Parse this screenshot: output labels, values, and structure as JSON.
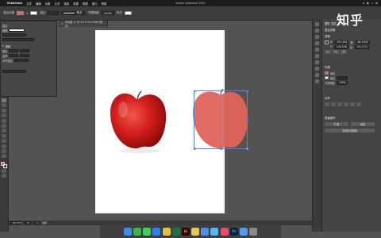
{
  "menubar": {
    "apple": "",
    "app_name": "Illustrator",
    "menus": [
      "文件",
      "编辑",
      "对象",
      "文字",
      "选择",
      "效果",
      "视图",
      "窗口",
      "帮助"
    ],
    "window_title": "Adobe Illustrator 2021",
    "status_items": [
      "⌂",
      "◐",
      "⌕",
      "⚙"
    ]
  },
  "controlbar": {
    "label_path": "混合对象",
    "stroke_label": "描边",
    "stroke_value": "",
    "style_label": "基本",
    "opacity_label": "不透明度",
    "opacity_value": "100%",
    "style_name": "样式"
  },
  "doctab": {
    "name": "未标题-1* @ 50.77% (CMYK/预览)",
    "close": "×"
  },
  "strokepanel": {
    "header": "描边",
    "weight_label": "粗细",
    "section2": "透明",
    "rows": [
      "端点",
      "边角",
      "对齐描边"
    ]
  },
  "properties": {
    "tabs": [
      "属性",
      "图层",
      "库"
    ],
    "header_selection": "混合对象",
    "transform_header": "变换",
    "x_label": "X:",
    "x_value": "303.164",
    "w_label": "宽:",
    "w_value": "88.1509",
    "y_label": "Y:",
    "y_value": "146.546",
    "h_label": "高:",
    "h_value": "93.2711",
    "appearance_header": "外观",
    "fill_label": "填色",
    "stroke_label": "描边",
    "opacity_label": "不透明度",
    "opacity_value": "100%",
    "align_header": "对齐",
    "quick_header": "快速操作",
    "btn_expand": "扩展",
    "btn_release": "释放",
    "btn_recolor": "重新着色图稿"
  },
  "statusbar": {
    "zoom": "50.77%",
    "angle": "0°",
    "page": "1",
    "tool": "选择"
  },
  "dock": {
    "icons": [
      {
        "name": "finder",
        "label": "",
        "color": "#3b8ef0"
      },
      {
        "name": "wechat",
        "label": "",
        "color": "#3bb54a"
      },
      {
        "name": "messages",
        "label": "",
        "color": "#3fd15c"
      },
      {
        "name": "safari",
        "label": "",
        "color": "#2d7ff9"
      },
      {
        "name": "chrome",
        "label": "",
        "color": "#e8c23b"
      },
      {
        "name": "excel",
        "label": "",
        "color": "#1f7244"
      },
      {
        "name": "illustrator",
        "label": "Ai",
        "color": "#330000"
      },
      {
        "name": "notes",
        "label": "",
        "color": "#e7c94b"
      },
      {
        "name": "mail",
        "label": "",
        "color": "#4b8ff5"
      },
      {
        "name": "files",
        "label": "",
        "color": "#57b6f0"
      },
      {
        "name": "music",
        "label": "",
        "color": "#f04a6a"
      },
      {
        "name": "photoshop",
        "label": "Ps",
        "color": "#0a2036"
      },
      {
        "name": "app-store",
        "label": "",
        "color": "#4aa0f5"
      },
      {
        "name": "trash",
        "label": "",
        "color": "#8a8a8a"
      }
    ]
  },
  "watermark": "知乎",
  "colors": {
    "apple_red": "#d41e1e",
    "blend_fill": "#e2645a",
    "selection": "#5b80d9"
  }
}
